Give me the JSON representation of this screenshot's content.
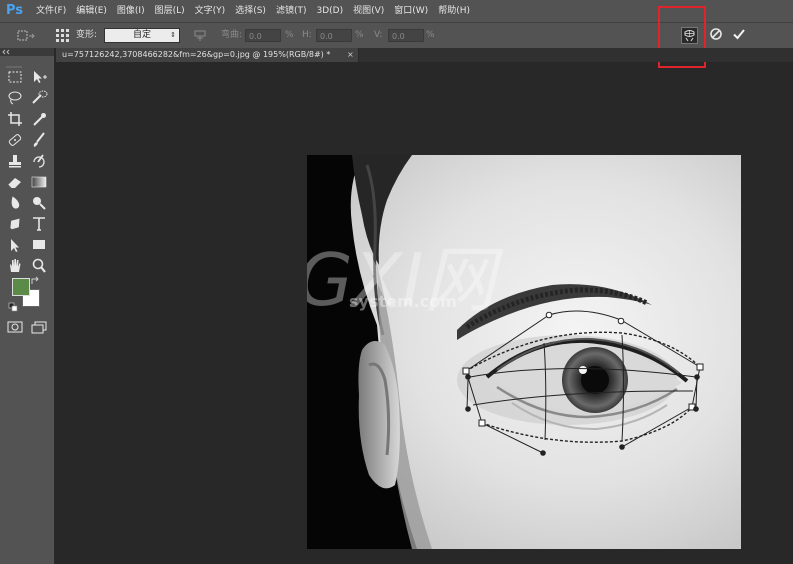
{
  "app": {
    "logo": "Ps"
  },
  "menu": [
    "文件(F)",
    "编辑(E)",
    "图像(I)",
    "图层(L)",
    "文字(Y)",
    "选择(S)",
    "滤镜(T)",
    "3D(D)",
    "视图(V)",
    "窗口(W)",
    "帮助(H)"
  ],
  "options": {
    "warp_label": "变形:",
    "warp_value": "自定",
    "bend_label": "弯曲:",
    "bend_value": "0.0",
    "h_label": "H:",
    "h_value": "0.0",
    "v_label": "V:",
    "v_value": "0.0",
    "percent": "%"
  },
  "document": {
    "tab_title": "u=757126242,3708466282&fm=26&gp=0.jpg @ 195%(RGB/8#) *",
    "close": "×"
  },
  "colors": {
    "foreground": "#5b8b48",
    "background": "#ffffff",
    "highlight": "#e0242b"
  },
  "watermark": {
    "text_large": "GXI网",
    "text_small": "system.com"
  },
  "icons": {
    "mode_button": "warp-mode-icon",
    "cancel": "cancel-icon",
    "commit": "checkmark-icon"
  }
}
